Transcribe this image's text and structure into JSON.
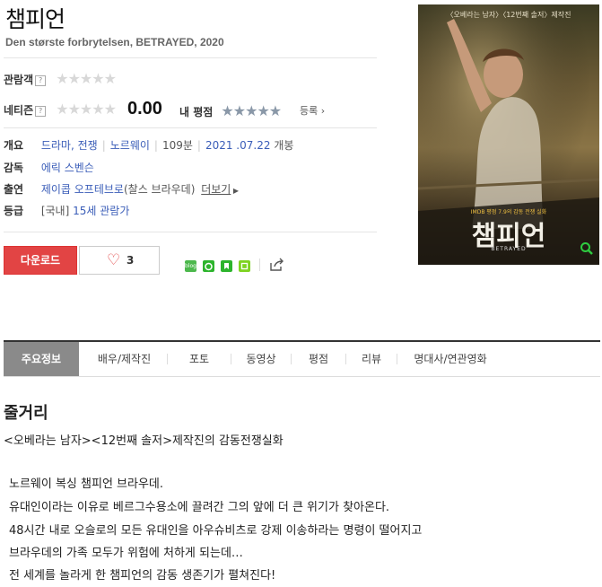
{
  "title": "챔피언",
  "original_title": "Den største forbrytelsen, BETRAYED, 2020",
  "ratings": {
    "audience_label": "관람객",
    "netizen_label": "네티즌",
    "netizen_score": "0.00",
    "my_rating_label": "내 평점",
    "register_label": "등록",
    "help_mark": "?",
    "stars": "★★★★★"
  },
  "info": {
    "overview_label": "개요",
    "genres": [
      "드라마",
      "전쟁"
    ],
    "country": "노르웨이",
    "runtime": "109분",
    "release_date": "2021 .07.22",
    "release_suffix": "개봉",
    "director_label": "감독",
    "director": "에릭 스벤슨",
    "cast_label": "출연",
    "cast_name": "제이콥 오프테브로",
    "cast_role": "(찰스 브라우데)",
    "more_label": "더보기",
    "grade_label": "등급",
    "grade_prefix": "[국내]",
    "grade": "15세 관람가"
  },
  "actions": {
    "download_label": "다운로드",
    "like_count": "3"
  },
  "share_icons": [
    {
      "name": "blog-icon",
      "label": "blog",
      "color": "#4cb84c"
    },
    {
      "name": "cafe-icon",
      "label": "",
      "color": "#2db42d"
    },
    {
      "name": "bookmark-icon",
      "label": "",
      "color": "#2db42d"
    },
    {
      "name": "memo-icon",
      "label": "",
      "color": "#7ed321"
    }
  ],
  "poster": {
    "top_text": "〈오베라는 남자〉〈12번째 솔저〉제작진",
    "tagline": "IMDB 평점 7.9의 감동 전쟁 실화",
    "title": "챔피언",
    "subtitle": "BETRAYED"
  },
  "tabs": [
    "주요정보",
    "배우/제작진",
    "포토",
    "동영상",
    "평점",
    "리뷰",
    "명대사/연관영화"
  ],
  "synopsis": {
    "heading": "줄거리",
    "tagline": "<오베라는 남자><12번째 솔저>제작진의 감동전쟁실화",
    "lines": [
      "노르웨이 복싱 챔피언 브라우데.",
      "유대인이라는 이유로 베르그수용소에 끌려간 그의 앞에 더 큰 위기가 찾아온다.",
      "48시간 내로 오슬로의 모든 유대인을 아우슈비츠로 강제 이송하라는 명령이 떨어지고",
      "브라우데의 가족 모두가 위험에 처하게 되는데…",
      "전 세계를 놀라게 한 챔피언의 감동 생존기가 펼쳐진다!"
    ]
  },
  "colors": {
    "accent_red": "#e24444",
    "link_blue": "#3a5db8",
    "tab_active": "#8a8a8a"
  }
}
